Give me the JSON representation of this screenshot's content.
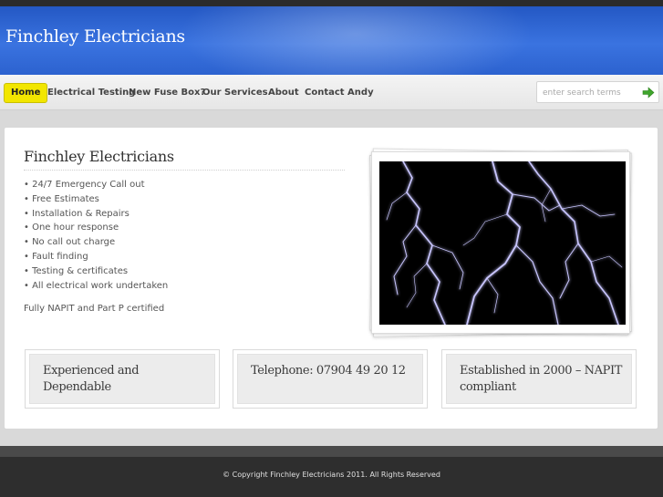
{
  "site": {
    "title": "Finchley Electricians"
  },
  "nav": {
    "items": [
      {
        "label": "Home",
        "active": true
      },
      {
        "label": "Electrical Testing"
      },
      {
        "label": "New Fuse Box?"
      },
      {
        "label": "Our Services"
      },
      {
        "label": "About"
      },
      {
        "label": "Contact Andy"
      }
    ]
  },
  "search": {
    "placeholder": "enter search terms",
    "button_icon": "right-arrow-icon",
    "button_color": "#3fa52c"
  },
  "intro": {
    "title": "Finchley Electricians",
    "services": [
      "• 24/7 Emergency Call out",
      "• Free Estimates",
      "• Installation & Repairs",
      "• One hour response",
      "• No call out charge",
      "• Fault finding",
      "• Testing & certificates",
      "• All electrical work undertaken"
    ],
    "certification": "Fully NAPIT and Part P certified"
  },
  "photo": {
    "subject": "lightning-image"
  },
  "boxes": [
    {
      "text": "Experienced and Dependable"
    },
    {
      "text": "Telephone: 07904 49 20 12"
    },
    {
      "text": "Established in 2000 – NAPIT compliant"
    }
  ],
  "footer": {
    "copyright": "© Copyright Finchley Electricians 2011. All Rights Reserved"
  },
  "colors": {
    "header_blue": "#3a73e0",
    "active_nav": "#f2e600",
    "footer": "#2e2e2e"
  }
}
